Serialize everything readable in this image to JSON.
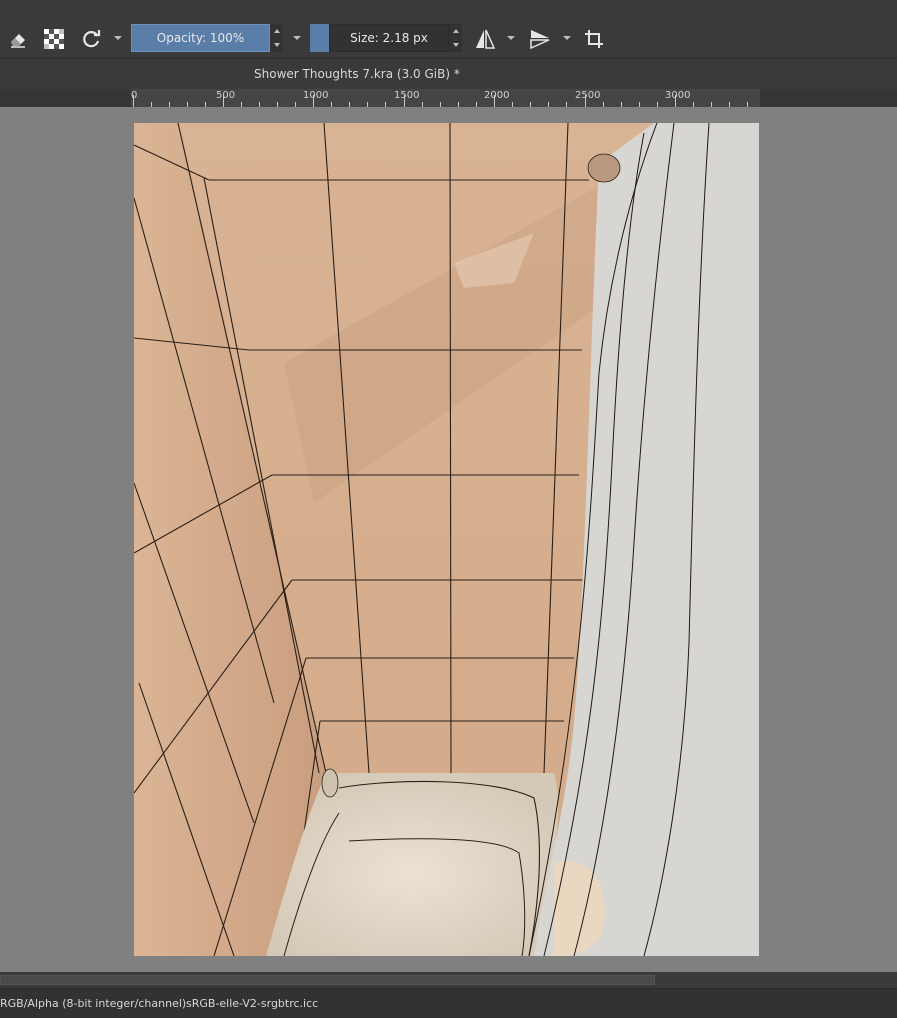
{
  "toolbar": {
    "opacity_label": "Opacity: 100%",
    "size_label": "Size: 2.18 px",
    "icons": [
      "eraser-icon",
      "alpha-lock-icon",
      "reload-preset-icon",
      "mirror-horizontal-icon",
      "mirror-vertical-icon",
      "wrap-around-icon"
    ]
  },
  "document": {
    "title": "Shower Thoughts 7.kra (3.0 GiB) *"
  },
  "ruler": {
    "labels": [
      "0",
      "500",
      "1000",
      "1500",
      "2000",
      "2500",
      "3000"
    ]
  },
  "status": {
    "color_model": "RGB/Alpha (8-bit integer/channel)",
    "profile": "sRGB-elle-V2-srgbtrc.icc"
  },
  "colors": {
    "ui_dark": "#3a3a3a",
    "canvas_bg": "#808080",
    "accent_blue": "#5b7ea8",
    "tile_peach": "#d6ad8c",
    "curtain_grey": "#d7d6d3",
    "tub_cream": "#e6ddd0"
  }
}
